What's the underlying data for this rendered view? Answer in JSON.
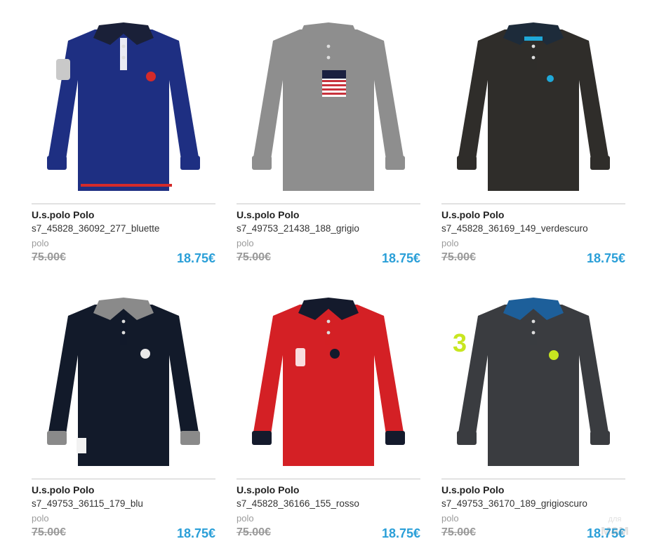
{
  "products": [
    {
      "brand": "U.s.polo Polo",
      "code": "s7_45828_36092_277_bluette",
      "category": "polo",
      "old_price": "75.00€",
      "new_price": "18.75€",
      "colors": {
        "body": "#1e2f82",
        "collar": "#1a2038",
        "cuff": "#1e2f82",
        "placket": "#ffffff",
        "hem": "#d42a2a"
      }
    },
    {
      "brand": "U.s.polo Polo",
      "code": "s7_49753_21438_188_grigio",
      "category": "polo",
      "old_price": "75.00€",
      "new_price": "18.75€",
      "colors": {
        "body": "#8e8e8e",
        "collar": "#8e8e8e",
        "cuff": "#8e8e8e",
        "placket": "#8e8e8e",
        "pocket": "#c8323c"
      }
    },
    {
      "brand": "U.s.polo Polo",
      "code": "s7_45828_36169_149_verdescuro",
      "category": "polo",
      "old_price": "75.00€",
      "new_price": "18.75€",
      "colors": {
        "body": "#2f2d2a",
        "collar": "#1d2b3a",
        "cuff": "#2f2d2a",
        "placket": "#2f2d2a",
        "accent": "#1fa8d8"
      }
    },
    {
      "brand": "U.s.polo Polo",
      "code": "s7_49753_36115_179_blu",
      "category": "polo",
      "old_price": "75.00€",
      "new_price": "18.75€",
      "colors": {
        "body": "#121a2a",
        "collar": "#8a8a8a",
        "cuff": "#8a8a8a",
        "placket": "#121a2a"
      }
    },
    {
      "brand": "U.s.polo Polo",
      "code": "s7_45828_36166_155_rosso",
      "category": "polo",
      "old_price": "75.00€",
      "new_price": "18.75€",
      "colors": {
        "body": "#d42025",
        "collar": "#141a2c",
        "cuff": "#141a2c",
        "placket": "#d42025"
      }
    },
    {
      "brand": "U.s.polo Polo",
      "code": "s7_49753_36170_189_grigioscuro",
      "category": "polo",
      "old_price": "75.00€",
      "new_price": "18.75€",
      "colors": {
        "body": "#3a3c40",
        "collar": "#1d5f9a",
        "cuff": "#3a3c40",
        "placket": "#3a3c40",
        "accent": "#c8e620"
      }
    }
  ],
  "watermark": "для мам"
}
